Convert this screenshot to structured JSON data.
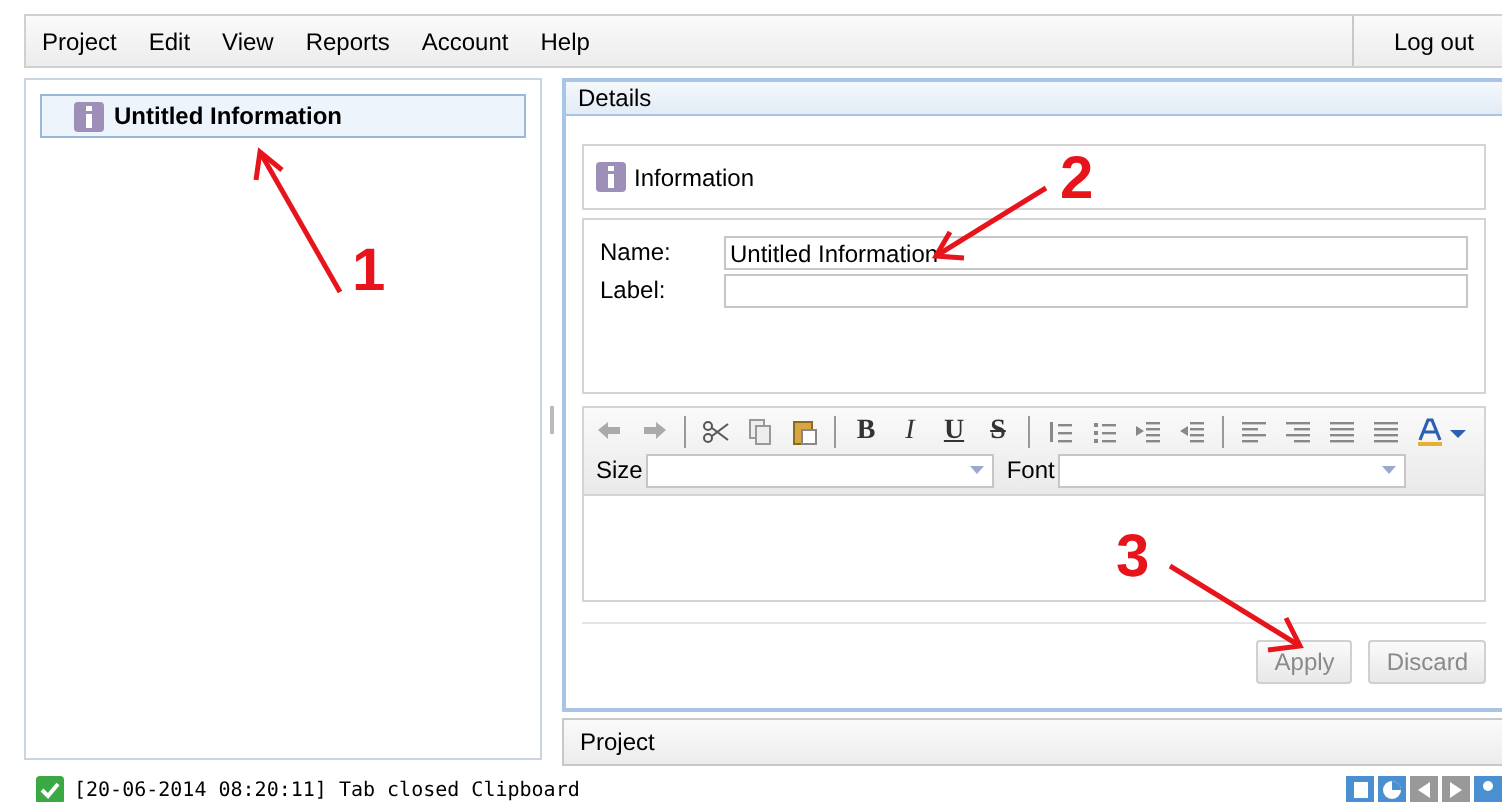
{
  "menu": {
    "items": [
      "Project",
      "Edit",
      "View",
      "Reports",
      "Account",
      "Help"
    ],
    "logout": "Log out"
  },
  "tree": {
    "items": [
      {
        "label": "Untitled Information",
        "selected": true
      }
    ]
  },
  "details": {
    "title": "Details",
    "header": "Information",
    "fields": [
      {
        "label": "Name:",
        "value": "Untitled Information"
      },
      {
        "label": "Label:"
      }
    ],
    "format_buttons": [
      {
        "label": "B",
        "kind": "bold"
      },
      {
        "label": "I",
        "kind": "italic"
      },
      {
        "label": "U",
        "kind": "underline"
      },
      {
        "label": "S",
        "kind": "strike"
      }
    ],
    "size_label": "Size",
    "font_label": "Font",
    "buttons": [
      {
        "label": "Apply",
        "disabled": true
      },
      {
        "label": "Discard",
        "disabled": true
      }
    ]
  },
  "project_bar": "Project",
  "status": "[20-06-2014 08:20:11] Tab closed Clipboard",
  "annotations": [
    "1",
    "2",
    "3"
  ]
}
